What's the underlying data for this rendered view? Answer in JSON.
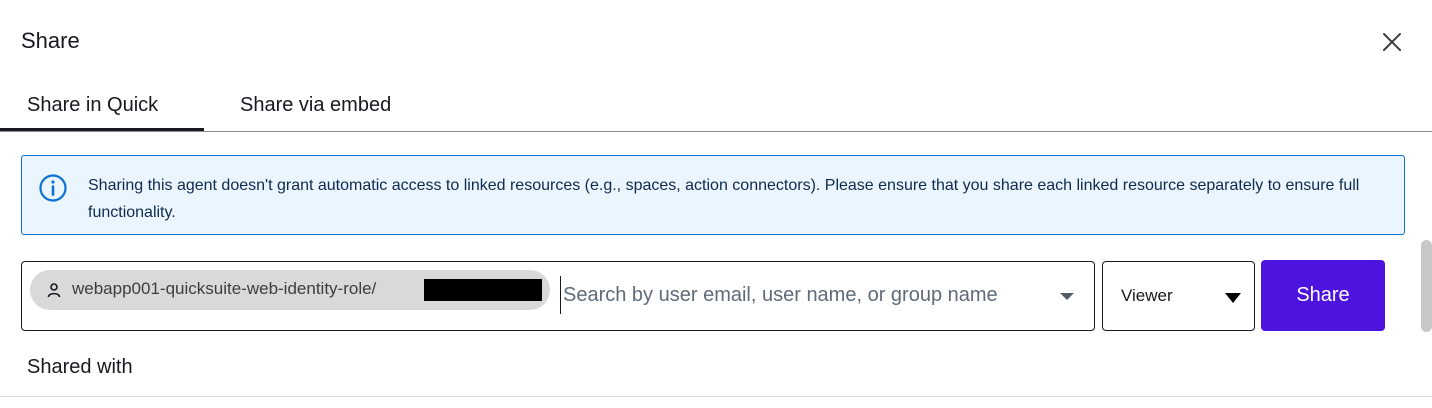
{
  "dialog": {
    "title": "Share",
    "close_icon": "close-icon"
  },
  "tabs": [
    {
      "label": "Share in Quick",
      "active": true
    },
    {
      "label": "Share via embed",
      "active": false
    }
  ],
  "alert": {
    "icon": "info-icon",
    "text": "Sharing this agent doesn't grant automatic access to linked resources (e.g., spaces, action connectors). Please ensure that you share each linked resource separately to ensure full functionality."
  },
  "share_form": {
    "token": {
      "icon": "user-icon",
      "label": "webapp001-quicksuite-web-identity-role/"
    },
    "search_placeholder": "Search by user email, user name, or group name",
    "search_value": "",
    "permission_select": {
      "selected": "Viewer"
    },
    "share_button_label": "Share"
  },
  "shared_with_heading": "Shared with",
  "colors": {
    "accent": "#4d14e0",
    "alert_bg": "#eaf5fd",
    "alert_border": "#0972d3",
    "text": "#16191f"
  }
}
